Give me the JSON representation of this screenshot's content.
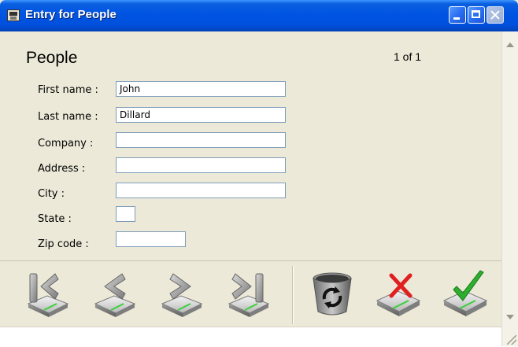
{
  "window": {
    "title": "Entry for People"
  },
  "form": {
    "heading": "People",
    "record_position": "1 of 1",
    "fields": [
      {
        "label": "First name :",
        "value": "John"
      },
      {
        "label": "Last name :",
        "value": "Dillard"
      },
      {
        "label": "Company :",
        "value": ""
      },
      {
        "label": "Address :",
        "value": ""
      },
      {
        "label": "City :",
        "value": ""
      },
      {
        "label": "State :",
        "value": ""
      },
      {
        "label": "Zip code :",
        "value": ""
      }
    ]
  },
  "toolbar": {
    "icons": [
      "first-record-icon",
      "previous-record-icon",
      "next-record-icon",
      "last-record-icon",
      "delete-recycle-icon",
      "cancel-x-icon",
      "save-check-icon"
    ],
    "colors": {
      "cancel": "#e02020",
      "save": "#2eae2e",
      "drive": "#b8b8b8",
      "accent_green": "#3ccf3c"
    }
  },
  "colors": {
    "titlebar": "#0054e3",
    "window_bg": "#ece9d8"
  }
}
